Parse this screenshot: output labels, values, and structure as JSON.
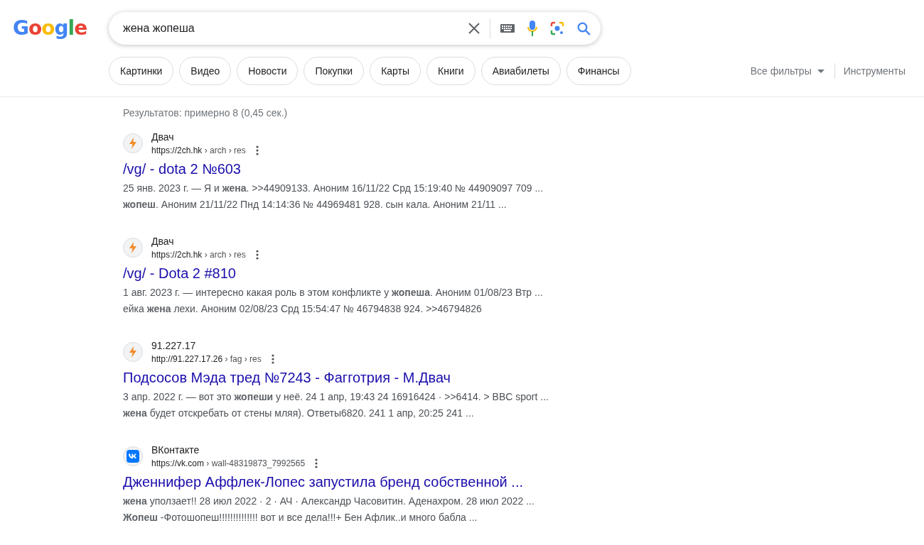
{
  "logo": "Google",
  "search": {
    "value": "жена жопеша"
  },
  "chips": [
    {
      "label": "Картинки"
    },
    {
      "label": "Видео"
    },
    {
      "label": "Новости"
    },
    {
      "label": "Покупки"
    },
    {
      "label": "Карты"
    },
    {
      "label": "Книги"
    },
    {
      "label": "Авиабилеты"
    },
    {
      "label": "Финансы"
    }
  ],
  "filters": {
    "all_filters": "Все фильтры",
    "tools": "Инструменты"
  },
  "stats": "Результатов: примерно 8 (0,45 сек.)",
  "results": [
    {
      "kind": "bolt",
      "site": "Двач",
      "domain": "https://2ch.hk",
      "path": " › arch › res",
      "title": "/vg/ - dota 2 №603",
      "snippet": [
        "25 янв. 2023 г. — Я и **жена**. >>44909133. Аноним 16/11/22 Срд 15:19:40 № 44909097 709 ...",
        "**жопеш**. Аноним 21/11/22 Пнд 14:14:36 № 44969481 928. сын кала. Аноним 21/11 ..."
      ]
    },
    {
      "kind": "bolt",
      "site": "Двач",
      "domain": "https://2ch.hk",
      "path": " › arch › res",
      "title": "/vg/ - Dota 2 #810",
      "snippet": [
        "1 авг. 2023 г. — интересно какая роль в этом конфликте у **жопеша**. Аноним 01/08/23 Втр ...",
        "ейка **жена** лехи. Аноним 02/08/23 Срд 15:54:47 № 46794838 924. >>46794826"
      ]
    },
    {
      "kind": "bolt",
      "site": "91.227.17",
      "domain": "http://91.227.17.26",
      "path": " › fag › res",
      "title": "Подсосов Мэда тред №7243 - Фагготрия - М.Двач",
      "snippet": [
        "3 апр. 2022 г. — вот это **жопеши** у неё. 24 1 апр, 19:43 24 16916424 · >>6414. > BBC sport ...",
        "**жена** будет отскребать от стены мляя). Ответы6820. 241 1 апр, 20:25 241 ..."
      ]
    },
    {
      "kind": "vk",
      "site": "ВКонтакте",
      "domain": "https://vk.com",
      "path": " › wall-48319873_7992565",
      "title": "Дженнифер Аффлек-Лопес запустила бренд собственной ...",
      "snippet": [
        "**жена** уползает!! 28 июл 2022 · 2 · АЧ · Александр Часовитин. Аденахром. 28 июл 2022 ...",
        "**Жопеш** -Фотошопеш!!!!!!!!!!!!!! вот и все дела!!!+ Бен Афлик..и много бабла ..."
      ]
    }
  ]
}
